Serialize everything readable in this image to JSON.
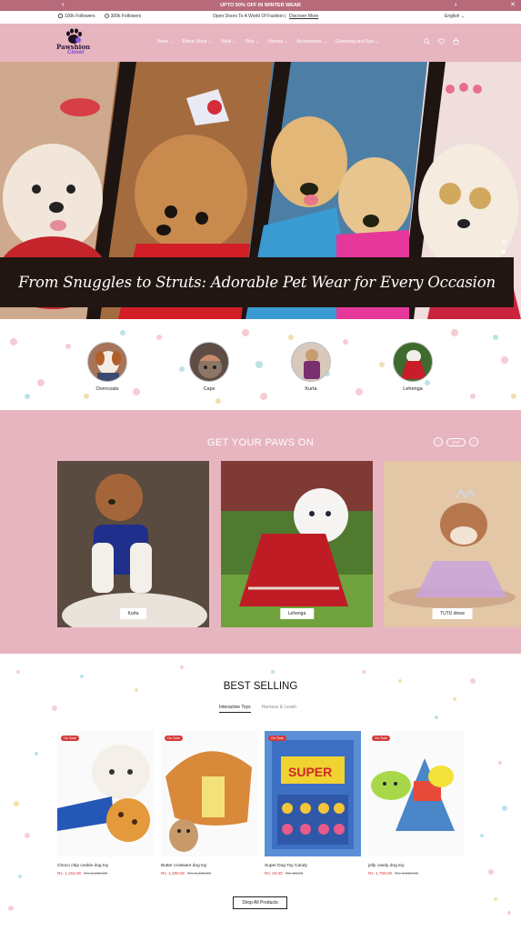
{
  "announcement": {
    "text": "UPTO 50% OFF IN WINTER WEAR",
    "prev": "‹",
    "next": "›",
    "close": "✕"
  },
  "utility": {
    "instagram": "100k Followers",
    "facebook": "300k Followers",
    "tagline": "Open Doors To A World Of Fashion |",
    "discover": "Discover More",
    "language": "English ⌄"
  },
  "logo": {
    "line1": "Pawshion",
    "line2": "Closet"
  },
  "nav": [
    "Wear",
    "Ethnic Wear",
    "Walk",
    "Play",
    "Homes",
    "Accessories",
    "Grooming and Spa"
  ],
  "hero": {
    "caption": "From Snuggles to Struts: Adorable Pet Wear for Every Occasion"
  },
  "categories": [
    "Overcoats",
    "Caps",
    "Kurta",
    "Lehenga"
  ],
  "paws": {
    "title": "GET YOUR PAWS ON",
    "pager": "1/10",
    "cards": [
      "Kurta",
      "Lehenga",
      "TUTU dress"
    ]
  },
  "best": {
    "title": "BEST SELLING",
    "tabs": [
      "Interactive Toys",
      "Harness & Leash"
    ],
    "badge": "On Sale",
    "products": [
      {
        "name": "Choco chip cookie dog toy",
        "price": "Rs. 1,163.00",
        "old": "Rs. 1,299.00"
      },
      {
        "name": "Butter croissant dog toy",
        "price": "Rs. 1,299.00",
        "old": "Rs. 1,460.00"
      },
      {
        "name": "Super Dog Toy Candy",
        "price": "Rs. 20.00",
        "old": "Rs. 30.00"
      },
      {
        "name": "jelly candy dog toy",
        "price": "Rs. 1,709.00",
        "old": "Rs. 1,899.00"
      }
    ],
    "cta": "Shop All Products"
  },
  "colors": {
    "announce": "#b76a7a",
    "header": "#e7b5c0",
    "sale": "#d63a3a",
    "banner": "#221612"
  }
}
